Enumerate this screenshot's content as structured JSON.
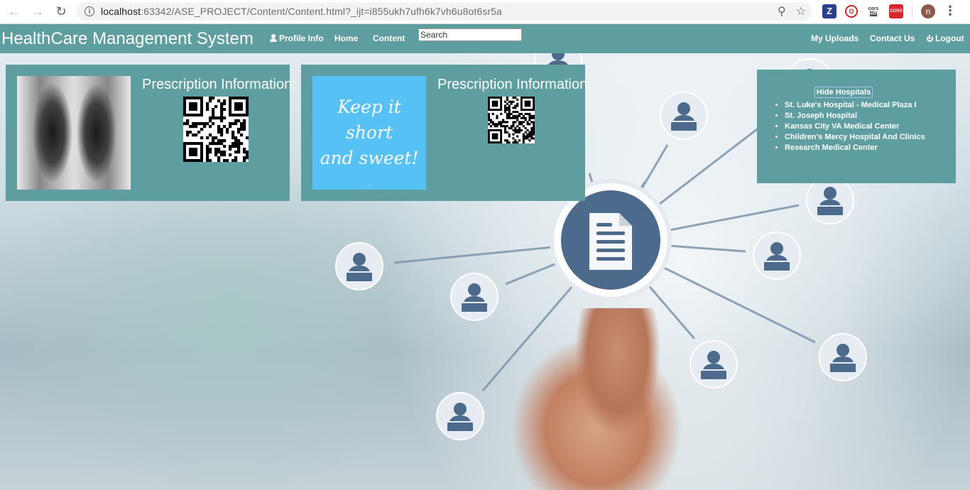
{
  "browser": {
    "url_host": "localhost",
    "url_rest": ":63342/ASE_PROJECT/Content/Content.html?_ijt=i855ukh7ufh6k7vh6u8ot6sr5a",
    "ext_z": "Z",
    "ext_cors_off_top": "cors",
    "ext_cors_off_bottom": "off",
    "ext_cors": "CORS",
    "avatar_letter": "n"
  },
  "navbar": {
    "brand": "HealthCare Management System",
    "profile": "Profile Info",
    "home": "Home",
    "content": "Content",
    "search_placeholder": "Search",
    "uploads": "My Uploads",
    "contact": "Contact Us",
    "logout": "Logout"
  },
  "cards": [
    {
      "title": "Prescription Information:"
    },
    {
      "title": "Prescription Information:",
      "image_line1": "Keep it short",
      "image_line2": "and sweet!"
    }
  ],
  "hospitals": {
    "toggle_label": "Hide Hospitals",
    "items": [
      "St. Luke's Hospital - Medical Plaza I",
      "St. Joseph Hospital",
      "Kansas City VA Medical Center",
      "Children's Mercy Hospital And Clinics",
      "Research Medical Center"
    ]
  },
  "colors": {
    "teal": "#5f9ea0",
    "node_blue": "#4b6a8c",
    "sky": "#56c1f5"
  }
}
